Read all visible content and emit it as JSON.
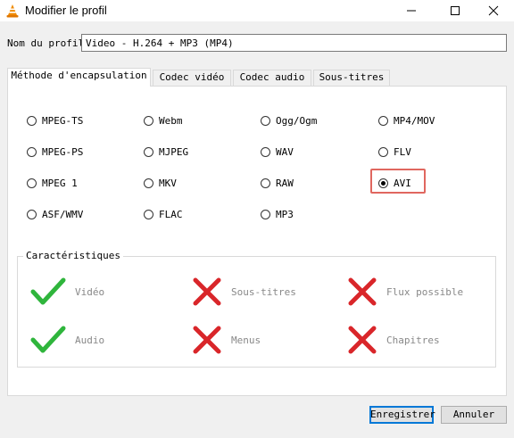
{
  "window": {
    "title": "Modifier le profil"
  },
  "profile": {
    "label": "Nom du profil",
    "value": "Video - H.264 + MP3 (MP4)"
  },
  "tabs": [
    {
      "label": "Méthode d'encapsulation",
      "active": true
    },
    {
      "label": "Codec vidéo",
      "active": false
    },
    {
      "label": "Codec audio",
      "active": false
    },
    {
      "label": "Sous-titres",
      "active": false
    }
  ],
  "containers": [
    {
      "label": "MPEG-TS",
      "checked": false
    },
    {
      "label": "Webm",
      "checked": false
    },
    {
      "label": "Ogg/Ogm",
      "checked": false
    },
    {
      "label": "MP4/MOV",
      "checked": false
    },
    {
      "label": "MPEG-PS",
      "checked": false
    },
    {
      "label": "MJPEG",
      "checked": false
    },
    {
      "label": "WAV",
      "checked": false
    },
    {
      "label": "FLV",
      "checked": false
    },
    {
      "label": "MPEG 1",
      "checked": false
    },
    {
      "label": "MKV",
      "checked": false
    },
    {
      "label": "RAW",
      "checked": false
    },
    {
      "label": "AVI",
      "checked": true
    },
    {
      "label": "ASF/WMV",
      "checked": false
    },
    {
      "label": "FLAC",
      "checked": false
    },
    {
      "label": "MP3",
      "checked": false
    }
  ],
  "features": {
    "title": "Caractéristiques",
    "items": [
      {
        "label": "Vidéo",
        "supported": true
      },
      {
        "label": "Sous-titres",
        "supported": false
      },
      {
        "label": "Flux possible",
        "supported": false
      },
      {
        "label": "Audio",
        "supported": true
      },
      {
        "label": "Menus",
        "supported": false
      },
      {
        "label": "Chapitres",
        "supported": false
      }
    ]
  },
  "buttons": {
    "save": "Enregistrer",
    "cancel": "Annuler"
  },
  "colors": {
    "check": "#2fb53c",
    "cross": "#d9262a",
    "highlight": "#e0675f",
    "vlc_orange": "#f08a00"
  }
}
